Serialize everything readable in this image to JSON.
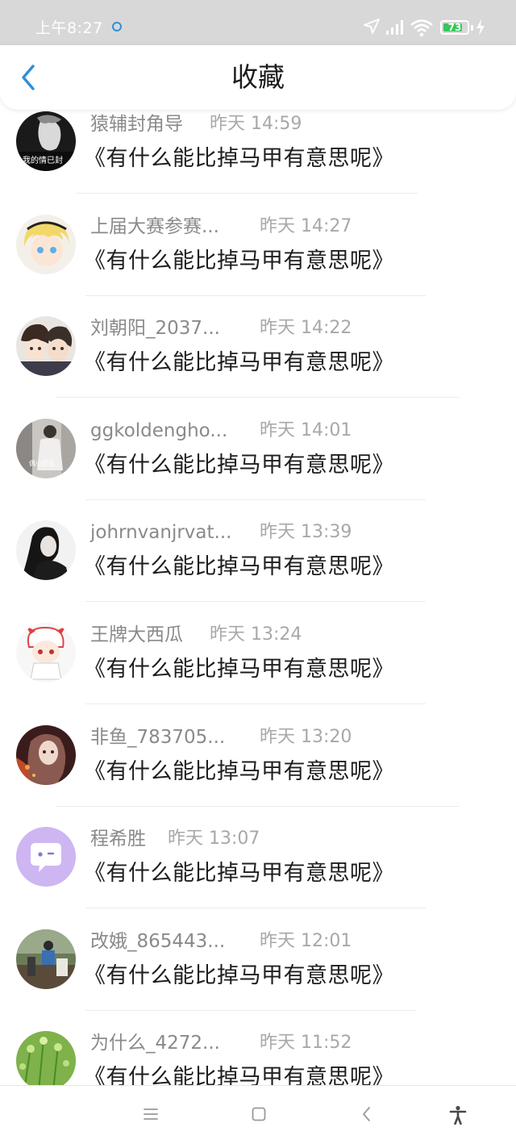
{
  "status_bar": {
    "time": "上午8:27",
    "battery": "73",
    "icons": [
      "location-icon",
      "signal-icon",
      "wifi-icon",
      "battery-icon",
      "charging-icon"
    ]
  },
  "header": {
    "title": "收藏",
    "back_icon": "chevron-left-icon",
    "accent_color": "#2f8fd6"
  },
  "items": [
    {
      "name": "猿辅封角导",
      "time": "昨天 14:59",
      "title": "《有什么能比掉马甲有意思呢》"
    },
    {
      "name": "上届大赛参赛...",
      "time": "昨天 14:27",
      "title": "《有什么能比掉马甲有意思呢》"
    },
    {
      "name": "刘朝阳_2037...",
      "time": "昨天 14:22",
      "title": "《有什么能比掉马甲有意思呢》"
    },
    {
      "name": "ggkoldengho...",
      "time": "昨天 14:01",
      "title": "《有什么能比掉马甲有意思呢》"
    },
    {
      "name": "johrnvanjrvat...",
      "time": "昨天 13:39",
      "title": "《有什么能比掉马甲有意思呢》"
    },
    {
      "name": "王牌大西瓜",
      "time": "昨天 13:24",
      "title": "《有什么能比掉马甲有意思呢》"
    },
    {
      "name": "非鱼_783705...",
      "time": "昨天 13:20",
      "title": "《有什么能比掉马甲有意思呢》"
    },
    {
      "name": "程希胜",
      "time": "昨天 13:07",
      "title": "《有什么能比掉马甲有意思呢》"
    },
    {
      "name": "改娥_865443...",
      "time": "昨天 12:01",
      "title": "《有什么能比掉马甲有意思呢》"
    },
    {
      "name": "为什么_4272...",
      "time": "昨天 11:52",
      "title": "《有什么能比掉马甲有意思呢》"
    }
  ],
  "avatar_text": {
    "item0": "我的情已封",
    "item3": "偶小团总"
  },
  "nav_bar": {
    "icons": [
      "menu-icon",
      "home-icon",
      "back-icon",
      "accessibility-icon"
    ]
  }
}
